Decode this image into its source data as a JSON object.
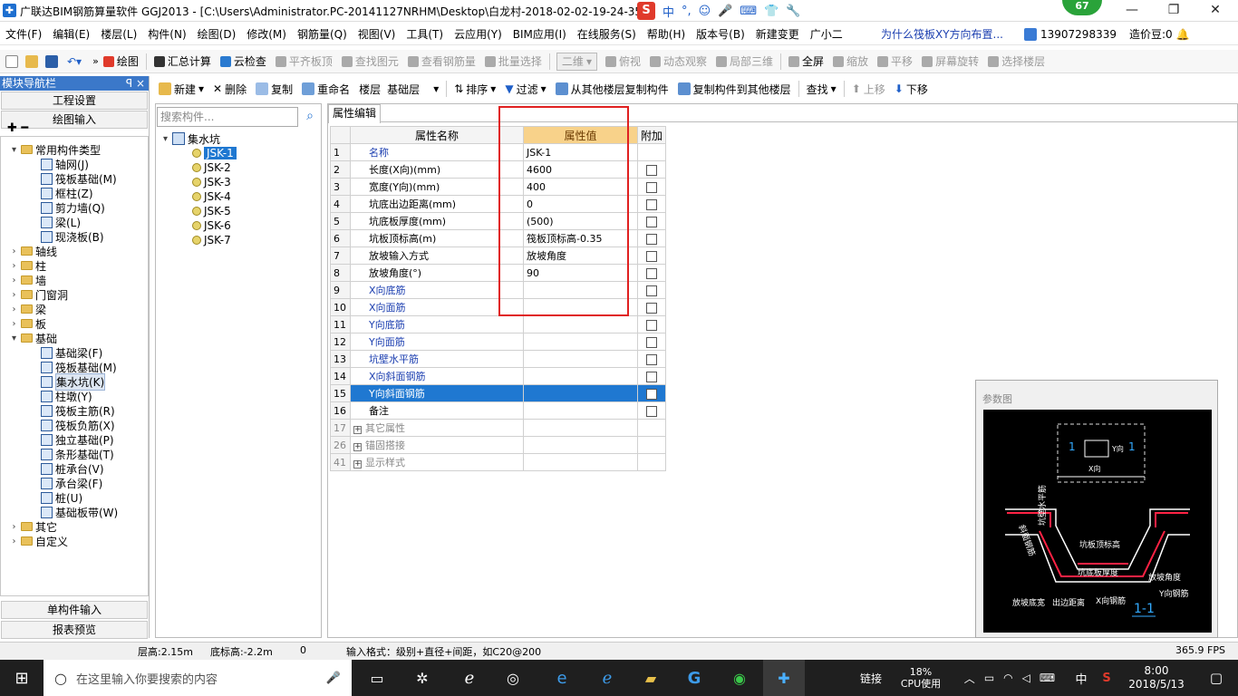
{
  "window": {
    "title": "广联达BIM钢筋算量软件 GGJ2013 - [C:\\Users\\Administrator.PC-20141127NRHM\\Desktop\\白龙村-2018-02-02-19-24-35",
    "badge": "67",
    "ime": {
      "label": "中",
      "punct": "°,"
    }
  },
  "menubar": {
    "items": [
      "文件(F)",
      "编辑(E)",
      "楼层(L)",
      "构件(N)",
      "绘图(D)",
      "修改(M)",
      "钢筋量(Q)",
      "视图(V)",
      "工具(T)",
      "云应用(Y)",
      "BIM应用(I)",
      "在线服务(S)",
      "帮助(H)",
      "版本号(B)",
      "新建变更",
      "广小二"
    ],
    "question": "为什么筏板XY方向布置...",
    "phone": "13907298339",
    "beans": "造价豆:0"
  },
  "toolbar1": {
    "items": [
      "绘图",
      "汇总计算",
      "云检查",
      "平齐板顶",
      "查找图元",
      "查看钢筋量",
      "批量选择",
      "二维",
      "俯视",
      "动态观察",
      "局部三维",
      "全屏",
      "缩放",
      "平移",
      "屏幕旋转",
      "选择楼层"
    ]
  },
  "toolbar2": {
    "new": "新建",
    "delete": "删除",
    "copy": "复制",
    "rename": "重命名",
    "floor_label": "楼层",
    "floor_value": "基础层",
    "sort": "排序",
    "filter": "过滤",
    "copy_from": "从其他楼层复制构件",
    "copy_to": "复制构件到其他楼层",
    "find": "查找",
    "up": "上移",
    "down": "下移"
  },
  "leftpanel": {
    "header": "模块导航栏",
    "pin": "ꟼ ×",
    "btn_project": "工程设置",
    "btn_draw": "绘图输入",
    "btn_single": "单构件输入",
    "btn_report": "报表预览",
    "tree": {
      "common": "常用构件类型",
      "common_items": [
        "轴网(J)",
        "筏板基础(M)",
        "框柱(Z)",
        "剪力墙(Q)",
        "梁(L)",
        "现浇板(B)"
      ],
      "groups1": [
        "轴线",
        "柱",
        "墙",
        "门窗洞",
        "梁",
        "板"
      ],
      "foundation": "基础",
      "foundation_items": [
        "基础梁(F)",
        "筏板基础(M)",
        "集水坑(K)",
        "柱墩(Y)",
        "筏板主筋(R)",
        "筏板负筋(X)",
        "独立基础(P)",
        "条形基础(T)",
        "桩承台(V)",
        "承台梁(F)",
        "桩(U)",
        "基础板带(W)"
      ],
      "groups2": [
        "其它",
        "自定义"
      ]
    }
  },
  "midpanel": {
    "search_placeholder": "搜索构件...",
    "root": "集水坑",
    "items": [
      "JSK-1",
      "JSK-2",
      "JSK-3",
      "JSK-4",
      "JSK-5",
      "JSK-6",
      "JSK-7"
    ]
  },
  "props": {
    "tab": "属性编辑",
    "col_name": "属性名称",
    "col_value": "属性值",
    "col_add": "附加",
    "rows": [
      {
        "n": "1",
        "name": "名称",
        "value": "JSK-1",
        "blue": true,
        "cb": false
      },
      {
        "n": "2",
        "name": "长度(X向)(mm)",
        "value": "4600",
        "blue": false,
        "cb": true
      },
      {
        "n": "3",
        "name": "宽度(Y向)(mm)",
        "value": "400",
        "blue": false,
        "cb": true
      },
      {
        "n": "4",
        "name": "坑底出边距离(mm)",
        "value": "0",
        "blue": false,
        "cb": true
      },
      {
        "n": "5",
        "name": "坑底板厚度(mm)",
        "value": "(500)",
        "blue": false,
        "cb": true
      },
      {
        "n": "6",
        "name": "坑板顶标高(m)",
        "value": "筏板顶标高-0.35",
        "blue": false,
        "cb": true
      },
      {
        "n": "7",
        "name": "放坡输入方式",
        "value": "放坡角度",
        "blue": false,
        "cb": true
      },
      {
        "n": "8",
        "name": "放坡角度(°)",
        "value": "90",
        "blue": false,
        "cb": true
      },
      {
        "n": "9",
        "name": "X向底筋",
        "value": "",
        "blue": true,
        "cb": true
      },
      {
        "n": "10",
        "name": "X向面筋",
        "value": "",
        "blue": true,
        "cb": true
      },
      {
        "n": "11",
        "name": "Y向底筋",
        "value": "",
        "blue": true,
        "cb": true
      },
      {
        "n": "12",
        "name": "Y向面筋",
        "value": "",
        "blue": true,
        "cb": true
      },
      {
        "n": "13",
        "name": "坑壁水平筋",
        "value": "",
        "blue": true,
        "cb": true
      },
      {
        "n": "14",
        "name": "X向斜面钢筋",
        "value": "",
        "blue": true,
        "cb": true
      },
      {
        "n": "15",
        "name": "Y向斜面钢筋",
        "value": "",
        "blue": true,
        "cb": true,
        "selected": true
      },
      {
        "n": "16",
        "name": "备注",
        "value": "",
        "blue": false,
        "cb": true
      }
    ],
    "groups": [
      {
        "n": "17",
        "name": "其它属性"
      },
      {
        "n": "26",
        "name": "锚固搭接"
      },
      {
        "n": "41",
        "name": "显示样式"
      }
    ]
  },
  "diagram": {
    "title": "参数图",
    "labels": {
      "one_a": "1",
      "one_b": "1",
      "y_dir": "Y向",
      "x_dir": "X向",
      "wall_h": "坑壁水平筋",
      "top_elev": "坑板顶标高",
      "slope_rebar": "斜面钢筋",
      "bottom_thick": "坑底板厚度",
      "slope_angle": "放坡角度",
      "y_rebar": "Y向钢筋",
      "slope_width": "放坡底宽",
      "edge_dist": "出边距离",
      "x_rebar": "X向钢筋",
      "section": "1-1"
    }
  },
  "statusbar": {
    "floor_h": "层高:2.15m",
    "bottom_elev": "底标高:-2.2m",
    "zero": "0",
    "format": "输入格式：级别+直径+间距，如C20@200",
    "fps": "365.9 FPS"
  },
  "taskbar": {
    "search": "在这里输入你要搜索的内容",
    "link": "链接",
    "cpu_pct": "18%",
    "cpu_label": "CPU使用",
    "lang": "中",
    "time": "8:00",
    "date": "2018/5/13"
  }
}
